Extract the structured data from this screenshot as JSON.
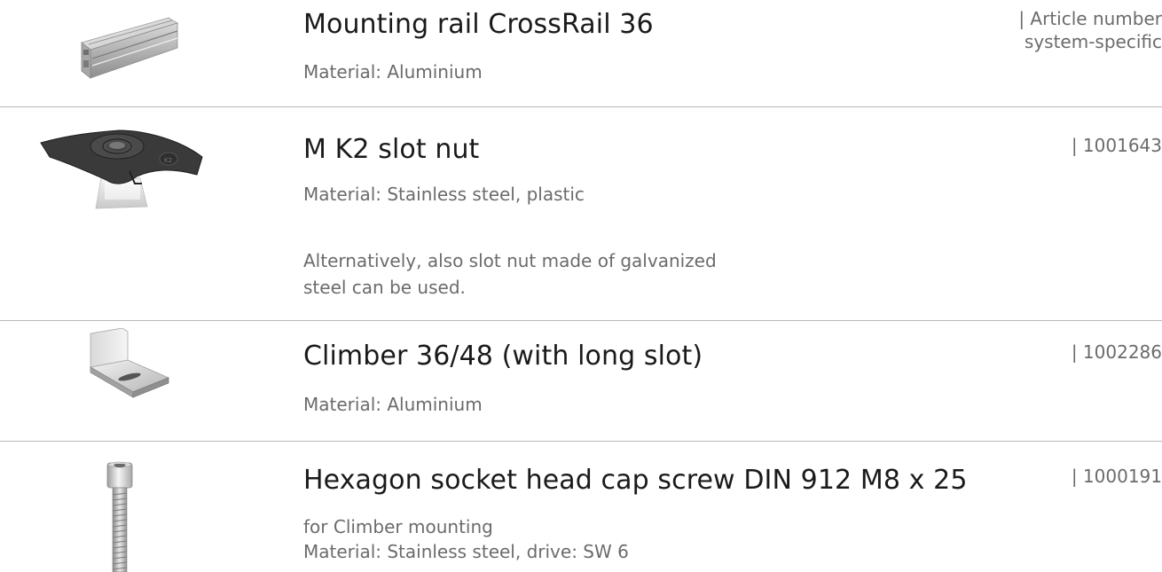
{
  "items": [
    {
      "title": "Mounting rail CrossRail 36",
      "material": "Material: Aluminium",
      "article_line1": "| Article number",
      "article_line2": "system-specific",
      "image": "mounting-rail-image"
    },
    {
      "title": "M K2 slot nut",
      "material": "Material: Stainless steel, plastic",
      "note_line1": "Alternatively, also slot nut made of galvanized",
      "note_line2": "steel can be used.",
      "article": "| 1001643",
      "image": "slot-nut-image"
    },
    {
      "title": "Climber 36/48 (with long slot)",
      "material": "Material: Aluminium",
      "article": "| 1002286",
      "image": "climber-image"
    },
    {
      "title": "Hexagon socket head cap screw DIN 912 M8 x 25",
      "purpose": "for Climber mounting",
      "material": "Material: Stainless steel, drive: SW 6",
      "article": "| 1000191",
      "image": "cap-screw-image"
    }
  ]
}
